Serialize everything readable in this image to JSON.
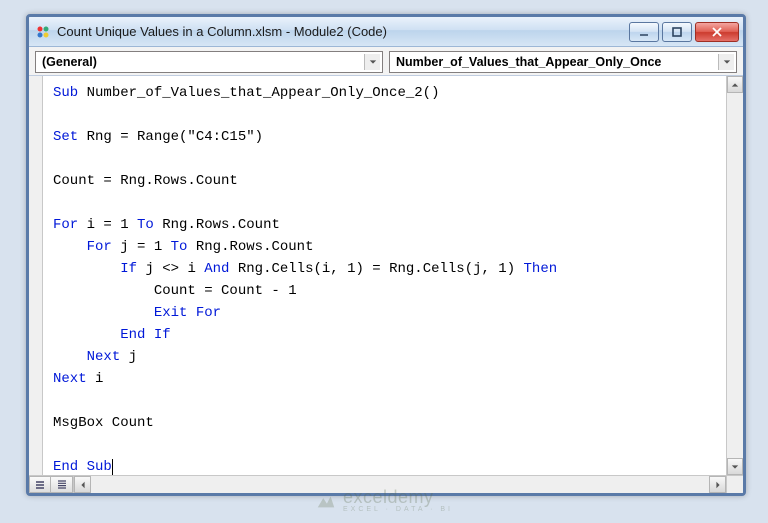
{
  "window": {
    "title": "Count Unique Values in a Column.xlsm - Module2 (Code)"
  },
  "dropdowns": {
    "object": "(General)",
    "procedure": "Number_of_Values_that_Appear_Only_Once"
  },
  "code": {
    "lines": [
      {
        "indent": 0,
        "spans": [
          {
            "t": "Sub ",
            "c": "kw"
          },
          {
            "t": "Number_of_Values_that_Appear_Only_Once_2()",
            "c": ""
          }
        ]
      },
      {
        "indent": 0,
        "spans": []
      },
      {
        "indent": 0,
        "spans": [
          {
            "t": "Set ",
            "c": "kw"
          },
          {
            "t": "Rng = Range(\"C4:C15\")",
            "c": ""
          }
        ]
      },
      {
        "indent": 0,
        "spans": []
      },
      {
        "indent": 0,
        "spans": [
          {
            "t": "Count = Rng.Rows.Count",
            "c": ""
          }
        ]
      },
      {
        "indent": 0,
        "spans": []
      },
      {
        "indent": 0,
        "spans": [
          {
            "t": "For ",
            "c": "kw"
          },
          {
            "t": "i = 1 ",
            "c": ""
          },
          {
            "t": "To ",
            "c": "kw"
          },
          {
            "t": "Rng.Rows.Count",
            "c": ""
          }
        ]
      },
      {
        "indent": 1,
        "spans": [
          {
            "t": "For ",
            "c": "kw"
          },
          {
            "t": "j = 1 ",
            "c": ""
          },
          {
            "t": "To ",
            "c": "kw"
          },
          {
            "t": "Rng.Rows.Count",
            "c": ""
          }
        ]
      },
      {
        "indent": 2,
        "spans": [
          {
            "t": "If ",
            "c": "kw"
          },
          {
            "t": "j <> i ",
            "c": ""
          },
          {
            "t": "And ",
            "c": "kw"
          },
          {
            "t": "Rng.Cells(i, 1) = Rng.Cells(j, 1) ",
            "c": ""
          },
          {
            "t": "Then",
            "c": "kw"
          }
        ]
      },
      {
        "indent": 3,
        "spans": [
          {
            "t": "Count = Count - 1",
            "c": ""
          }
        ]
      },
      {
        "indent": 3,
        "spans": [
          {
            "t": "Exit For",
            "c": "kw"
          }
        ]
      },
      {
        "indent": 2,
        "spans": [
          {
            "t": "End If",
            "c": "kw"
          }
        ]
      },
      {
        "indent": 1,
        "spans": [
          {
            "t": "Next ",
            "c": "kw"
          },
          {
            "t": "j",
            "c": ""
          }
        ]
      },
      {
        "indent": 0,
        "spans": [
          {
            "t": "Next ",
            "c": "kw"
          },
          {
            "t": "i",
            "c": ""
          }
        ]
      },
      {
        "indent": 0,
        "spans": []
      },
      {
        "indent": 0,
        "spans": [
          {
            "t": "MsgBox Count",
            "c": ""
          }
        ]
      },
      {
        "indent": 0,
        "spans": []
      },
      {
        "indent": 0,
        "spans": [
          {
            "t": "End Sub",
            "c": "kw"
          }
        ],
        "caret": true
      }
    ]
  },
  "watermark": {
    "name": "exceldemy",
    "tagline": "EXCEL · DATA · BI"
  }
}
